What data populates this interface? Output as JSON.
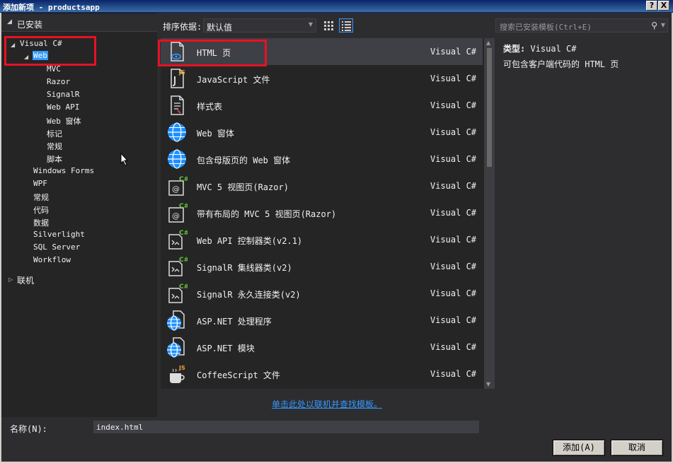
{
  "window": {
    "title": "添加新项 - productsapp",
    "help_btn": "?",
    "close_btn": "X"
  },
  "tree": {
    "installed": "已安装",
    "visual_csharp": "Visual C#",
    "web": "Web",
    "web_children": [
      "MVC",
      "Razor",
      "SignalR",
      "Web API",
      "Web 窗体",
      "标记",
      "常规",
      "脚本"
    ],
    "csharp_children": [
      "Windows Forms",
      "WPF",
      "常规",
      "代码",
      "数据",
      "Silverlight",
      "SQL Server",
      "Workflow"
    ],
    "online": "联机"
  },
  "toolbar": {
    "sort_label": "排序依据:",
    "sort_value": "默认值",
    "search_placeholder": "搜索已安装模板(Ctrl+E)"
  },
  "items": [
    {
      "name": "HTML 页",
      "lang": "Visual C#",
      "icon": "html-page-icon"
    },
    {
      "name": "JavaScript 文件",
      "lang": "Visual C#",
      "icon": "javascript-file-icon"
    },
    {
      "name": "样式表",
      "lang": "Visual C#",
      "icon": "stylesheet-icon"
    },
    {
      "name": "Web 窗体",
      "lang": "Visual C#",
      "icon": "globe-icon"
    },
    {
      "name": "包含母版页的 Web 窗体",
      "lang": "Visual C#",
      "icon": "globe-icon"
    },
    {
      "name": "MVC 5 视图页(Razor)",
      "lang": "Visual C#",
      "icon": "razor-view-icon"
    },
    {
      "name": "带有布局的 MVC 5 视图页(Razor)",
      "lang": "Visual C#",
      "icon": "razor-view-icon"
    },
    {
      "name": "Web API 控制器类(v2.1)",
      "lang": "Visual C#",
      "icon": "csharp-class-icon"
    },
    {
      "name": "SignalR 集线器类(v2)",
      "lang": "Visual C#",
      "icon": "csharp-class-icon"
    },
    {
      "name": "SignalR 永久连接类(v2)",
      "lang": "Visual C#",
      "icon": "csharp-class-icon"
    },
    {
      "name": "ASP.NET 处理程序",
      "lang": "Visual C#",
      "icon": "globe-file-icon"
    },
    {
      "name": "ASP.NET 模块",
      "lang": "Visual C#",
      "icon": "globe-file-icon"
    },
    {
      "name": "CoffeeScript 文件",
      "lang": "Visual C#",
      "icon": "coffeescript-icon"
    }
  ],
  "detail": {
    "type_label": "类型:",
    "type_value": "Visual C#",
    "description": "可包含客户端代码的 HTML 页"
  },
  "online_link": "单击此处以联机并查找模板。",
  "name_field": {
    "label": "名称(N):",
    "value": "index.html"
  },
  "buttons": {
    "add": "添加(A)",
    "cancel": "取消"
  },
  "colors": {
    "accent": "#3399ff",
    "highlight": "#e81123",
    "background": "#2d2d30"
  }
}
